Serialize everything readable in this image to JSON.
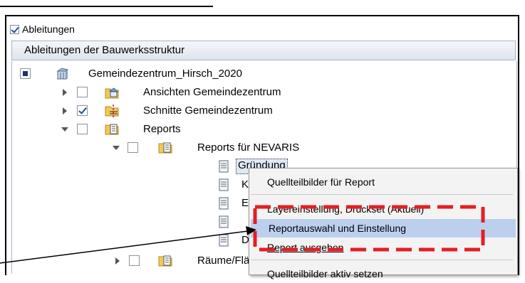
{
  "checkbox_row": {
    "label": "Ableitungen",
    "checked": true
  },
  "panel_header": "Ableitungen der Bauwerksstruktur",
  "tree": {
    "root": "Gemeindezentrum_Hirsch_2020",
    "ansichten": "Ansichten Gemeindezentrum",
    "schnitte": "Schnitte Gemeindezentrum",
    "reports": "Reports",
    "reports_nevaris": "Reports für NEVARIS",
    "item1": "Gründung",
    "item2": "K",
    "item3": "E",
    "item4": "",
    "item5": "D",
    "raeume": "Räume/Flä"
  },
  "context_menu": {
    "items": [
      {
        "label": "Quellteilbilder für Report"
      },
      {
        "label": "Layereinstellung, Druckset (Aktuell)"
      },
      {
        "label": "Reportauswahl und Einstellung",
        "highlighted": true
      },
      {
        "label": "Report ausgeben"
      },
      {
        "label": "Quellteilbilder aktiv setzen"
      }
    ]
  },
  "colors": {
    "highlight": "#bcd0ee",
    "annotation_dash": "#e31e24",
    "check": "#2a4e9a"
  }
}
